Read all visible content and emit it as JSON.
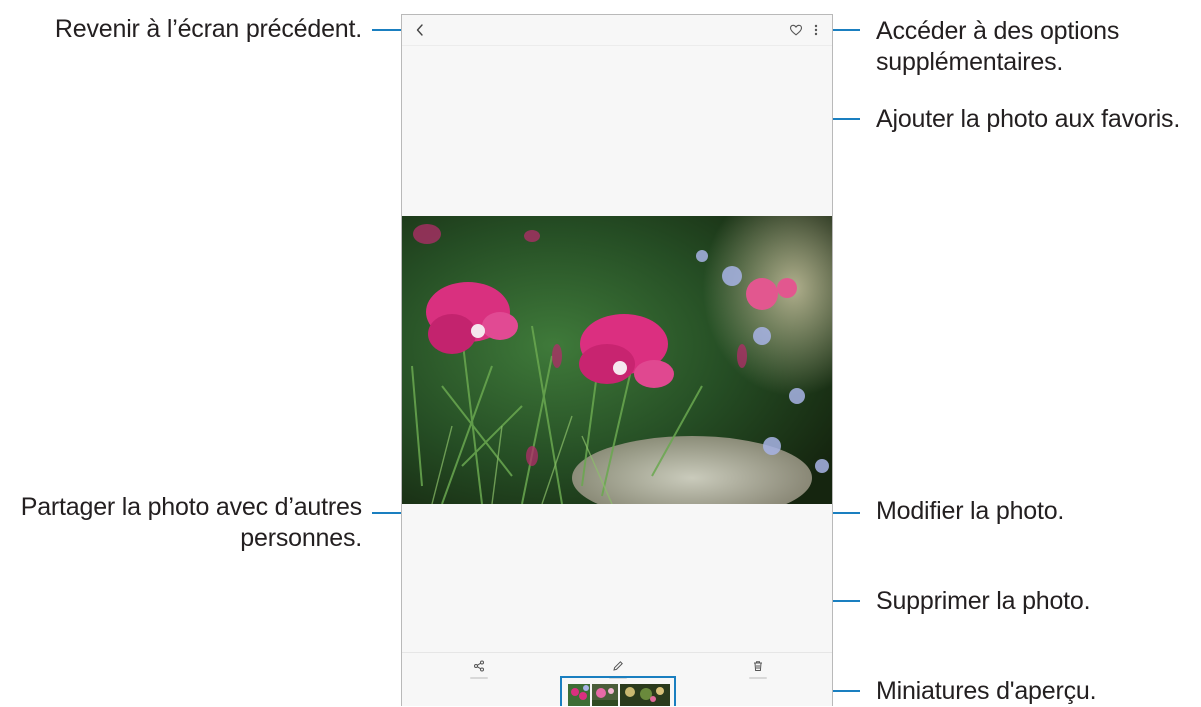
{
  "screen": {
    "toolbar_icons": [
      "back-icon",
      "heart-icon",
      "more-options-icon"
    ],
    "action_icons": [
      "share-icon",
      "edit-icon",
      "trash-icon"
    ],
    "accent_color": "#1a7fc0"
  },
  "callouts": {
    "back": "Revenir à l’écran précédent.",
    "more_options_line1": "Accéder à des options",
    "more_options_line2": "supplémentaires.",
    "favorite": "Ajouter la photo aux favoris.",
    "share_line1": "Partager la photo avec d’autres",
    "share_line2": "personnes.",
    "edit": "Modifier la photo.",
    "delete": "Supprimer la photo.",
    "thumbnails": "Miniatures d'aperçu."
  }
}
